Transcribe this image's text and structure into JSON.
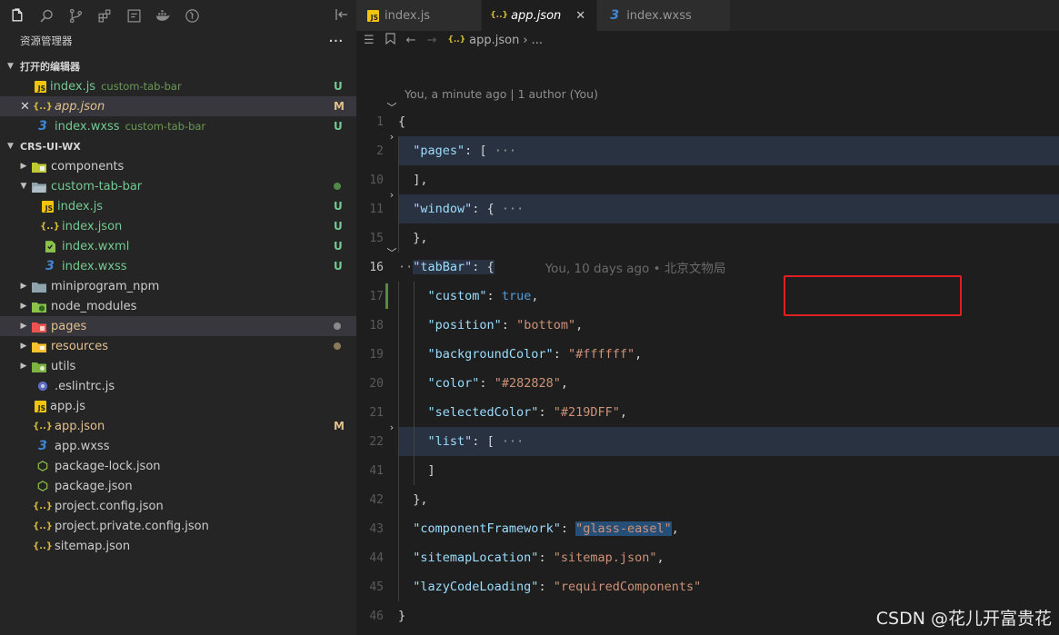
{
  "activity_bar": {
    "icons": [
      "files-icon",
      "search-icon",
      "source-control-icon",
      "extensions-icon",
      "remote-icon",
      "docker-icon",
      "git-icon"
    ],
    "right_icon": "split-editor-icon"
  },
  "explorer": {
    "title": "资源管理器",
    "more": "···",
    "open_editors": {
      "title": "打开的编辑器",
      "items": [
        {
          "name": "index.js",
          "desc": "custom-tab-bar",
          "badge": "U",
          "icon": "js"
        },
        {
          "name": "app.json",
          "desc": "",
          "badge": "M",
          "icon": "json",
          "close": "✕"
        },
        {
          "name": "index.wxss",
          "desc": "custom-tab-bar",
          "badge": "U",
          "icon": "wxss"
        }
      ]
    },
    "project": {
      "title": "CRS-UI-WX",
      "items": [
        {
          "name": "components"
        },
        {
          "name": "custom-tab-bar"
        },
        {
          "name": "index.js",
          "badge": "U"
        },
        {
          "name": "index.json",
          "badge": "U"
        },
        {
          "name": "index.wxml",
          "badge": "U"
        },
        {
          "name": "index.wxss",
          "badge": "U"
        },
        {
          "name": "miniprogram_npm"
        },
        {
          "name": "node_modules"
        },
        {
          "name": "pages"
        },
        {
          "name": "resources"
        },
        {
          "name": "utils"
        },
        {
          "name": ".eslintrc.js"
        },
        {
          "name": "app.js"
        },
        {
          "name": "app.json",
          "badge": "M"
        },
        {
          "name": "app.wxss"
        },
        {
          "name": "package-lock.json"
        },
        {
          "name": "package.json"
        },
        {
          "name": "project.config.json"
        },
        {
          "name": "project.private.config.json"
        },
        {
          "name": "sitemap.json"
        }
      ]
    }
  },
  "tabs": [
    {
      "label": "index.js"
    },
    {
      "label": "app.json",
      "close": "✕"
    },
    {
      "label": "index.wxss"
    }
  ],
  "breadcrumb": {
    "file": "app.json",
    "rest": "› ..."
  },
  "blame_header": "You, a minute ago | 1 author (You)",
  "line_numbers": [
    "1",
    "2",
    "10",
    "11",
    "15",
    "16",
    "17",
    "18",
    "19",
    "20",
    "21",
    "22",
    "41",
    "42",
    "43",
    "44",
    "45",
    "46"
  ],
  "code": {
    "l1": "{",
    "pages_key": "\"pages\"",
    "colon": ": ",
    "bracket_open": "[",
    "folded": "···",
    "bracket_close_comma": "],",
    "window_key": "\"window\"",
    "brace_open": "{",
    "brace_close_comma": "},",
    "tabbar_dots": "··",
    "tabbar_key": "\"tabBar\"",
    "tabbar_blame": "You, 10 days ago • 北京文物局",
    "custom_key": "\"custom\"",
    "custom_val": "true",
    "comma": ",",
    "position_key": "\"position\"",
    "position_val": "\"bottom\"",
    "bg_key": "\"backgroundColor\"",
    "bg_val": "\"#ffffff\"",
    "color_key": "\"color\"",
    "color_val": "\"#282828\"",
    "selcolor_key": "\"selectedColor\"",
    "selcolor_val": "\"#219DFF\"",
    "list_key": "\"list\"",
    "bracket_close": "]",
    "cf_key": "\"componentFramework\"",
    "cf_val": "\"glass-easel\"",
    "sitemap_key": "\"sitemapLocation\"",
    "sitemap_val": "\"sitemap.json\"",
    "lazy_key": "\"lazyCodeLoading\"",
    "lazy_val": "\"requiredComponents\"",
    "brace_close": "}"
  },
  "watermark": "CSDN @花儿开富贵花",
  "colors": {
    "accent_red": "#e02020",
    "git_untracked": "#73c991",
    "git_modified": "#e2c08d"
  }
}
